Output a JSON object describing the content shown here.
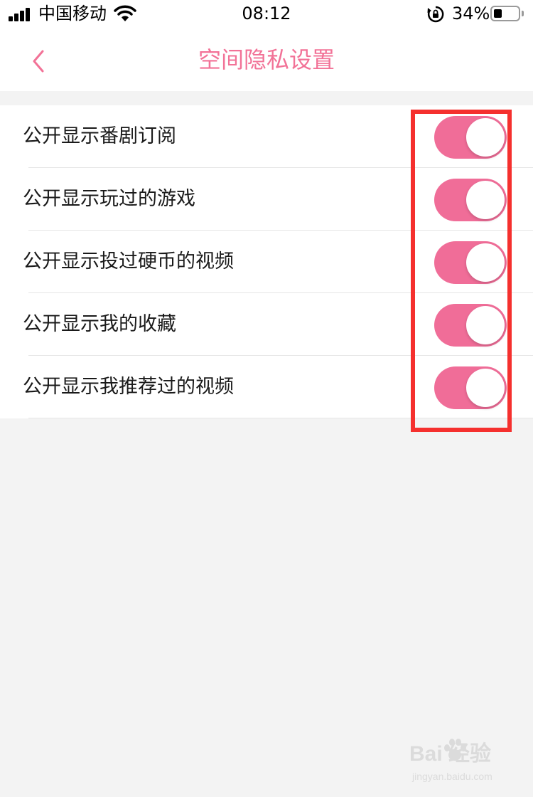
{
  "status_bar": {
    "carrier": "中国移动",
    "time": "08:12",
    "battery_percent": "34%",
    "battery_level": 0.34,
    "icons": [
      "signal-icon",
      "wifi-icon",
      "orientation-lock-icon",
      "battery-icon"
    ]
  },
  "header": {
    "title": "空间隐私设置",
    "back_icon": "chevron-left-icon"
  },
  "settings": [
    {
      "label": "公开显示番剧订阅",
      "enabled": true
    },
    {
      "label": "公开显示玩过的游戏",
      "enabled": true
    },
    {
      "label": "公开显示投过硬币的视频",
      "enabled": true
    },
    {
      "label": "公开显示我的收藏",
      "enabled": true
    },
    {
      "label": "公开显示我推荐过的视频",
      "enabled": true
    }
  ],
  "watermark": {
    "main": "Bai  经验",
    "sub": "jingyan.baidu.com"
  },
  "colors": {
    "accent": "#f27297",
    "toggle_on": "#f06d98",
    "highlight": "#f5302e",
    "page_bg": "#f3f3f3"
  }
}
